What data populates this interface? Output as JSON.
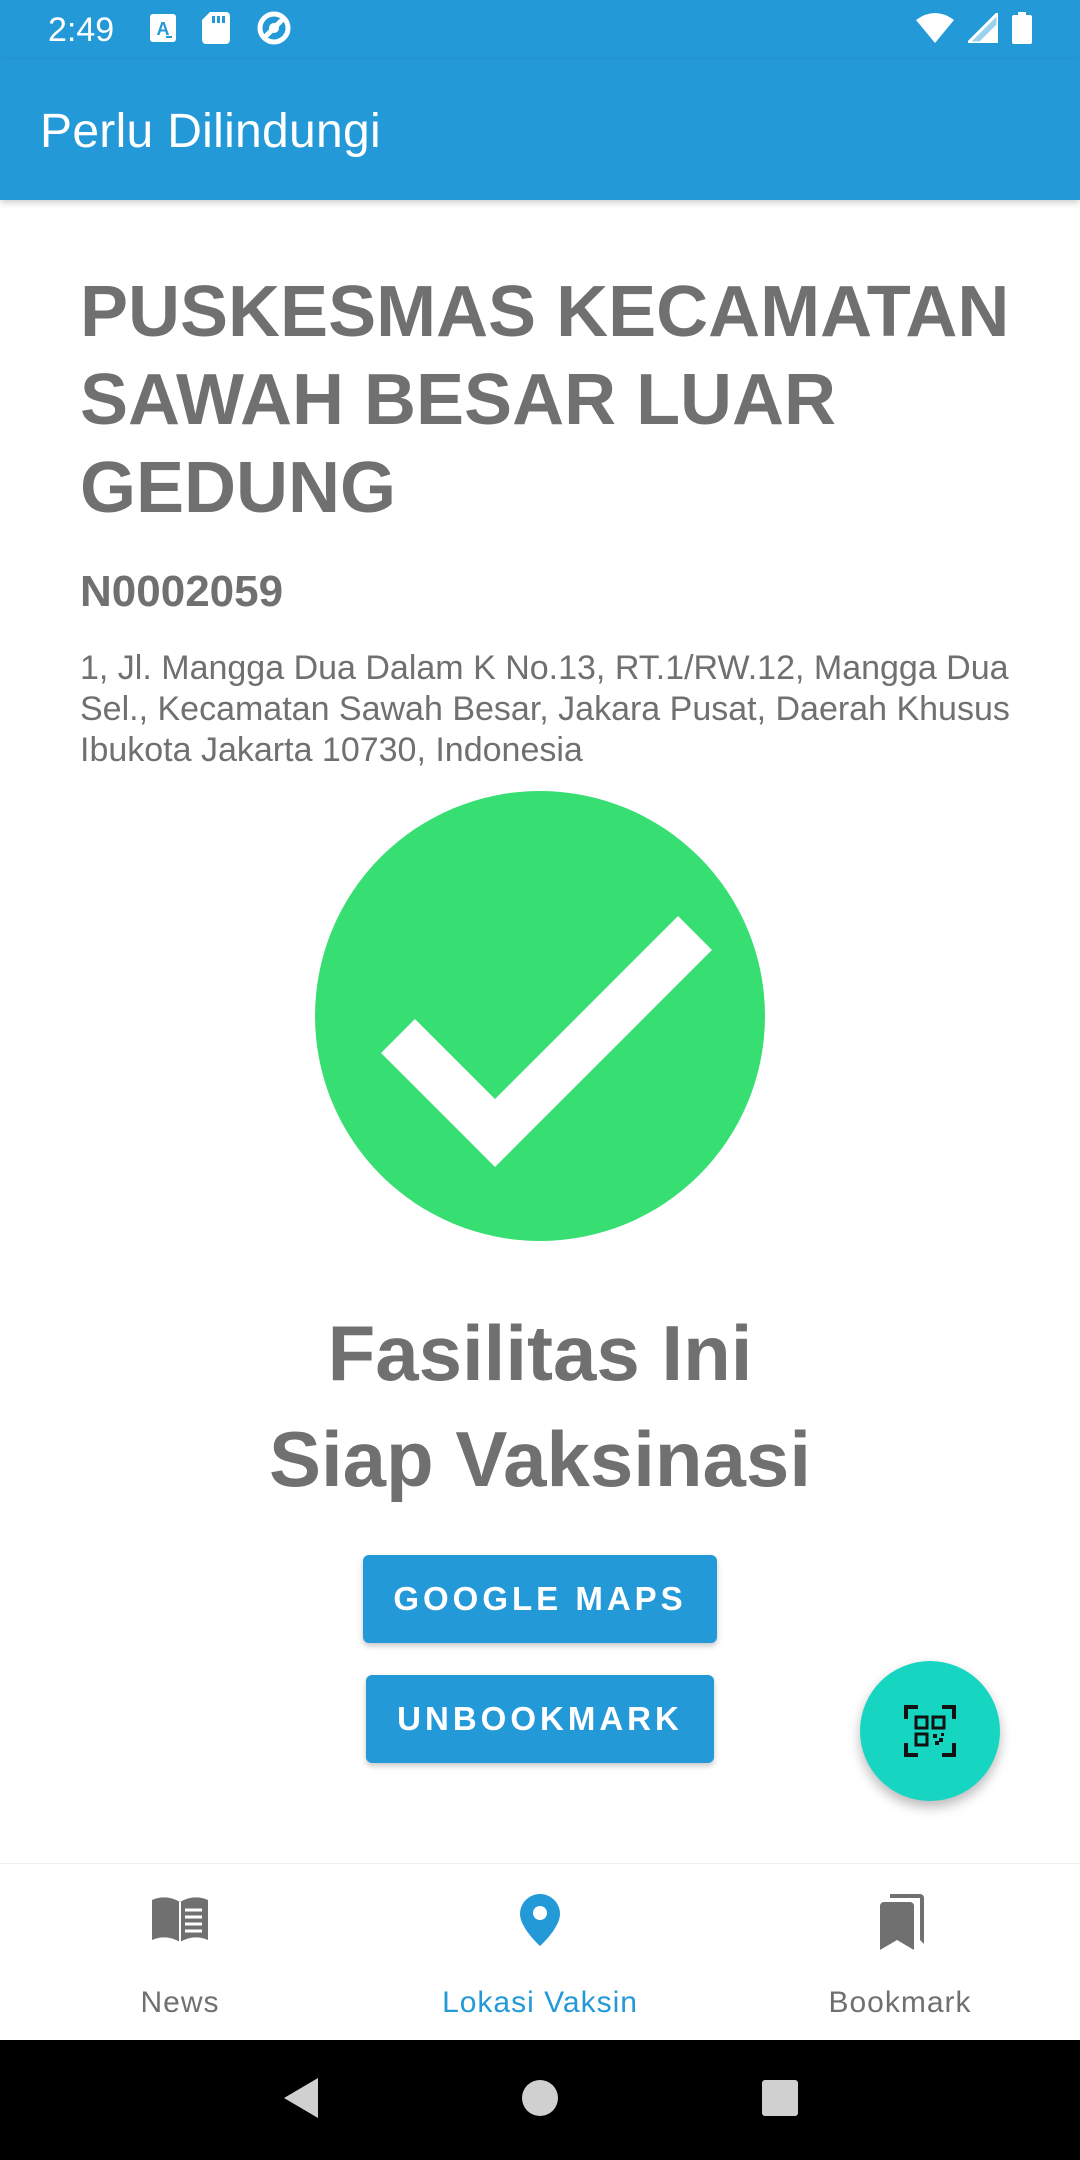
{
  "status_bar": {
    "time": "2:49",
    "left_icons": [
      "font-a-icon",
      "sd-card-icon",
      "sync-circle-icon"
    ],
    "right_icons": [
      "wifi-icon",
      "signal-icon",
      "battery-icon"
    ]
  },
  "app_bar": {
    "title": "Perlu Dilindungi",
    "color": "#2399d8"
  },
  "facility": {
    "name": "PUSKESMAS KECAMATAN SAWAH BESAR LUAR GEDUNG",
    "code": "N0002059",
    "address": "1, Jl. Mangga Dua Dalam K No.13, RT.1/RW.12, Mangga Dua Sel., Kecamatan Sawah Besar, Jakara Pusat, Daerah Khusus Ibukota Jakarta 10730, Indonesia"
  },
  "status": {
    "icon": "check-icon",
    "color": "#37de71",
    "line1": "Fasilitas Ini",
    "line2": "Siap Vaksinasi"
  },
  "actions": {
    "maps_label": "GOOGLE MAPS",
    "unbookmark_label": "UNBOOKMARK"
  },
  "fab": {
    "icon": "qr-scan-icon",
    "color": "#16d6c2"
  },
  "bottom_nav": {
    "items": [
      {
        "label": "News",
        "icon": "book-icon",
        "active": false
      },
      {
        "label": "Lokasi Vaksin",
        "icon": "location-pin-icon",
        "active": true
      },
      {
        "label": "Bookmark",
        "icon": "bookmark-icon",
        "active": false
      }
    ]
  },
  "system_nav": {
    "icons": [
      "back-icon",
      "home-icon",
      "recents-icon"
    ]
  }
}
